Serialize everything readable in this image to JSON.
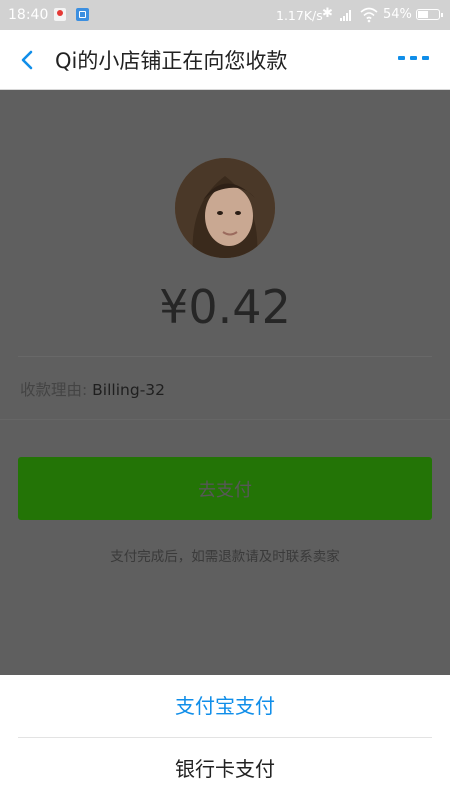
{
  "status_bar": {
    "time": "18:40",
    "net_speed": "1.17K/s",
    "battery_percent": "54%",
    "battery_level": 0.54
  },
  "header": {
    "title": "Qi的小店铺正在向您收款"
  },
  "payment": {
    "amount": "¥0.42",
    "reason_label": "收款理由:",
    "reason_value": "Billing-32",
    "pay_button": "去支付",
    "hint": "支付完成后，如需退款请及时联系卖家"
  },
  "sheet": {
    "options": [
      {
        "label": "支付宝支付"
      },
      {
        "label": "银行卡支付"
      }
    ]
  },
  "colors": {
    "accent": "#108ee9",
    "pay_button": "#237406",
    "overlay": "#5f5f5f"
  }
}
